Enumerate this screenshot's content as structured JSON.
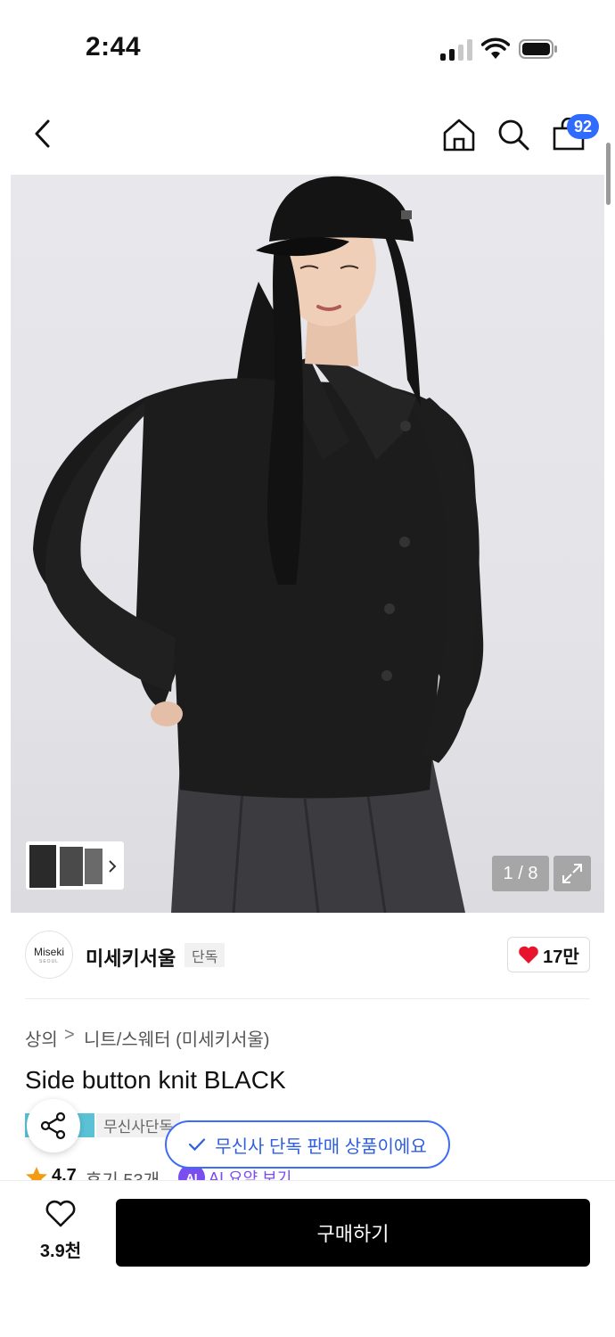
{
  "status_bar": {
    "time": "2:44"
  },
  "nav": {
    "back_icon": "chevron-left-icon",
    "home_icon": "home-icon",
    "search_icon": "search-icon",
    "cart_icon": "shopping-bag-icon",
    "cart_count": "92"
  },
  "gallery": {
    "counter": "1 / 8",
    "expand_icon": "expand-icon",
    "thumbnails_icon": "chevron-right-icon"
  },
  "brand": {
    "logo_text": "Miseki",
    "logo_subtext": "SEOUL",
    "name": "미세키서울",
    "tag": "단독",
    "like_count": "17만"
  },
  "breadcrumb": {
    "level1": "상의",
    "separator": ">",
    "level2": "니트/스웨터 (미세키서울)"
  },
  "product": {
    "title": "Side button knit BLACK",
    "badge": "무신사단독"
  },
  "toast": {
    "message": "무신사 단독 판매 상품이에요"
  },
  "rating": {
    "score": "4.7",
    "reviews": "후기 53개",
    "ai_badge": "AI",
    "ai_summary": "AI 요약 보기"
  },
  "bottom_bar": {
    "wish_count": "3.9천",
    "buy_label": "구매하기"
  },
  "colors": {
    "accent_blue": "#2f6bff",
    "heart_red": "#e8142e",
    "buy_button": "#000000"
  }
}
